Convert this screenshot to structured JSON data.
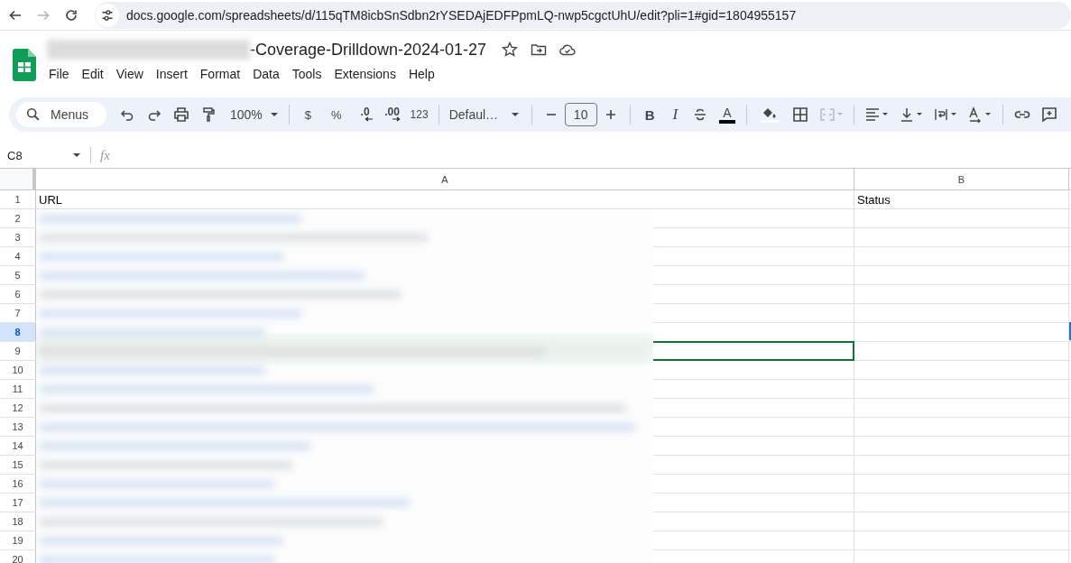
{
  "browser": {
    "url": "docs.google.com/spreadsheets/d/115qTM8icbSnSdbn2rYSEDAjEDFPpmLQ-nwp5cgctUhU/edit?pli=1#gid=1804955157",
    "forward_disabled": true
  },
  "document": {
    "title": "-Coverage-Drilldown-2024-01-27"
  },
  "menus": [
    "File",
    "Edit",
    "View",
    "Insert",
    "Format",
    "Data",
    "Tools",
    "Extensions",
    "Help"
  ],
  "toolbar": {
    "search_placeholder": "Menus",
    "zoom": "100%",
    "currency": "$",
    "percent": "%",
    "decrease_decimals": ".0",
    "increase_decimals": ".00",
    "number_format": "123",
    "font": "Defaul…",
    "font_size": "10",
    "bold": "B",
    "italic": "I",
    "text_color": "A",
    "merge_disabled": true
  },
  "formula_bar": {
    "name_box": "C8",
    "fx": "fx"
  },
  "columns": [
    {
      "label": "A",
      "selected": false
    },
    {
      "label": "B",
      "selected": false
    }
  ],
  "rows": [
    {
      "number": "1",
      "selected": false,
      "cells": [
        "URL",
        "Status"
      ]
    },
    {
      "number": "2",
      "selected": false
    },
    {
      "number": "3",
      "selected": false
    },
    {
      "number": "4",
      "selected": false
    },
    {
      "number": "5",
      "selected": false
    },
    {
      "number": "6",
      "selected": false
    },
    {
      "number": "7",
      "selected": false
    },
    {
      "number": "8",
      "selected": true
    },
    {
      "number": "9",
      "selected": false,
      "remote_selection": true
    },
    {
      "number": "10",
      "selected": false
    },
    {
      "number": "11",
      "selected": false
    },
    {
      "number": "12",
      "selected": false
    },
    {
      "number": "13",
      "selected": false
    },
    {
      "number": "14",
      "selected": false
    },
    {
      "number": "15",
      "selected": false
    },
    {
      "number": "16",
      "selected": false
    },
    {
      "number": "17",
      "selected": false
    },
    {
      "number": "18",
      "selected": false
    },
    {
      "number": "19",
      "selected": false
    },
    {
      "number": "20",
      "selected": false
    }
  ]
}
